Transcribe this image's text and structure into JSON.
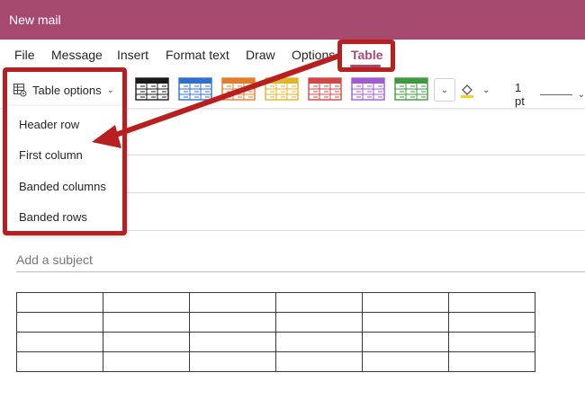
{
  "window": {
    "title": "New mail"
  },
  "menu": {
    "tabs": [
      {
        "label": "File"
      },
      {
        "label": "Message"
      },
      {
        "label": "Insert"
      },
      {
        "label": "Format text"
      },
      {
        "label": "Draw"
      },
      {
        "label": "Options"
      },
      {
        "label": "Table"
      }
    ],
    "active_tab": "Table"
  },
  "ribbon": {
    "table_options_label": "Table options",
    "table_style_colors": [
      "#1a1a1a",
      "#2f6fcf",
      "#e27e2a",
      "#e0b52a",
      "#d64545",
      "#a05bd1",
      "#3e9a3e"
    ],
    "border_weight_label": "1 pt"
  },
  "dropdown": {
    "items": [
      {
        "label": "Header row"
      },
      {
        "label": "First column"
      },
      {
        "label": "Banded columns"
      },
      {
        "label": "Banded rows"
      }
    ]
  },
  "compose": {
    "subject_placeholder": "Add a subject",
    "table": {
      "rows": 4,
      "cols": 6
    }
  },
  "colors": {
    "accent": "#a6496f",
    "callout": "#b81f1f"
  }
}
